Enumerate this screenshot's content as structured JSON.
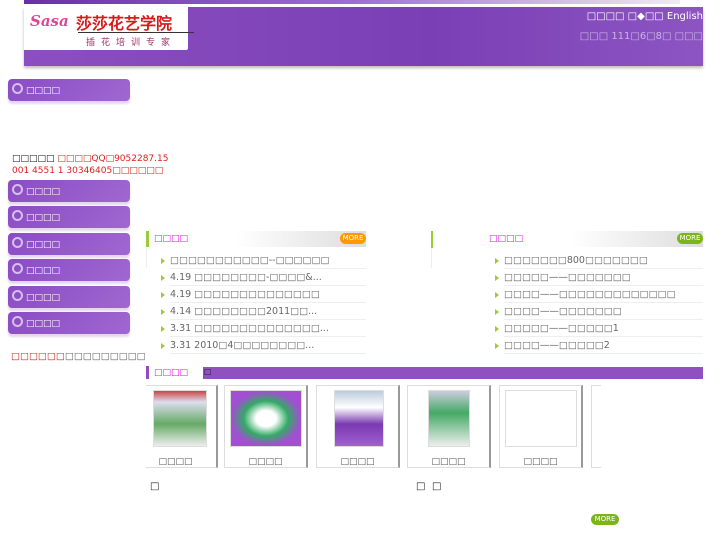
{
  "header": {
    "logo_mark": "Sasa",
    "logo_name": "莎莎花艺学院",
    "logo_sub": "插花培训专家",
    "links": "□□□□ □◆□□ English",
    "date": "□□□ 111□6□8□ □□□"
  },
  "sidebar": {
    "items": [
      {
        "label": "□□□□"
      },
      {
        "label": "□□□□"
      },
      {
        "label": "□□□□"
      },
      {
        "label": "□□□□"
      },
      {
        "label": "□□□□"
      },
      {
        "label": "□□□□"
      },
      {
        "label": "□□□□"
      }
    ],
    "contact_label": "□□□□□ ",
    "contact_value": "□□□□QQ□9052287.15",
    "contact_line2": "001 4551 1 30346405□□□□□□",
    "footer_red": "□□□□□□",
    "footer_gray": "□□□□□□□□□"
  },
  "news_left": {
    "title": "□□□□",
    "more": "MORE",
    "items": [
      "□□□□□□□□□□□--□□□□□□",
      "4.19 □□□□□□□□-□□□□&...",
      "4.19 □□□□□□□□□□□□□□",
      "4.14 □□□□□□□□2011□□...",
      "3.31 □□□□□□□□□□□□□□...",
      "3.31 2010□4□□□□□□□□..."
    ]
  },
  "news_right": {
    "title": "□□□□",
    "more": "MORE",
    "items": [
      "□□□□□□□800□□□□□□□",
      "□□□□□——□□□□□□□",
      "□□□□——□□□□□□□□□□□□□",
      "□□□□——□□□□□□□",
      "□□□□□——□□□□□1",
      "□□□□——□□□□□2"
    ]
  },
  "gallery": {
    "title": "□□□□",
    "bar_char": "□",
    "cards": [
      {
        "caption": "□□□□"
      },
      {
        "caption": "□□□□"
      },
      {
        "caption": "□□□□"
      },
      {
        "caption": "□□□□"
      },
      {
        "caption": "□□□□"
      }
    ],
    "more": "MORE"
  },
  "misc": {
    "c1": "□",
    "c2": "□",
    "c3": "□"
  }
}
